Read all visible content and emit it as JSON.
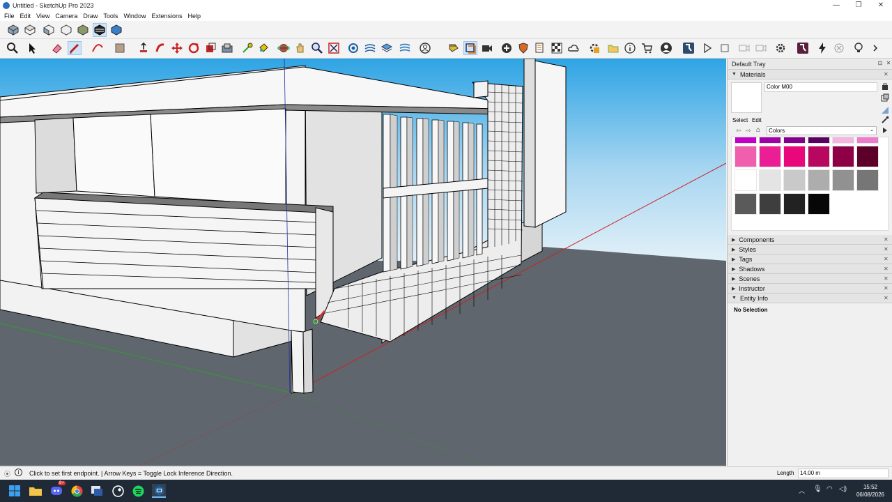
{
  "window": {
    "title": "Untitled - SketchUp Pro 2023"
  },
  "menu": [
    "File",
    "Edit",
    "View",
    "Camera",
    "Draw",
    "Tools",
    "Window",
    "Extensions",
    "Help"
  ],
  "tray": {
    "title": "Default Tray",
    "materials": {
      "header": "Materials",
      "name_value": "Color M00",
      "tab_select": "Select",
      "tab_edit": "Edit",
      "collection": "Colors",
      "swatches": [
        "#c000c8",
        "#a000a8",
        "#82008a",
        "#5a0060",
        "#f4b6e0",
        "#ee7acb",
        "#ef5fae",
        "#ec1e96",
        "#e8087c",
        "#b8075e",
        "#8d0045",
        "#5c0029",
        "#ffffff",
        "#e4e4e4",
        "#c9c9c9",
        "#adadad",
        "#919191",
        "#767676",
        "#5a5a5a",
        "#3e3e3e",
        "#222222",
        "#070707"
      ]
    },
    "panels": [
      "Components",
      "Styles",
      "Tags",
      "Shadows",
      "Scenes",
      "Instructor",
      "Entity Info"
    ],
    "entity_info": {
      "text": "No Selection"
    }
  },
  "status": {
    "message": "Click to set first endpoint. | Arrow Keys = Toggle Lock Inference Direction.",
    "length_label": "Length",
    "length_value": "14.00 m"
  },
  "taskbar": {
    "time": "15:52",
    "date": "06/08/2026",
    "discord_badge": "9+"
  },
  "colors": {
    "sky_top": "#2fa6e6",
    "sky_bottom": "#d9eef9",
    "ground": "#5f666d",
    "accent": "#0078d7"
  }
}
